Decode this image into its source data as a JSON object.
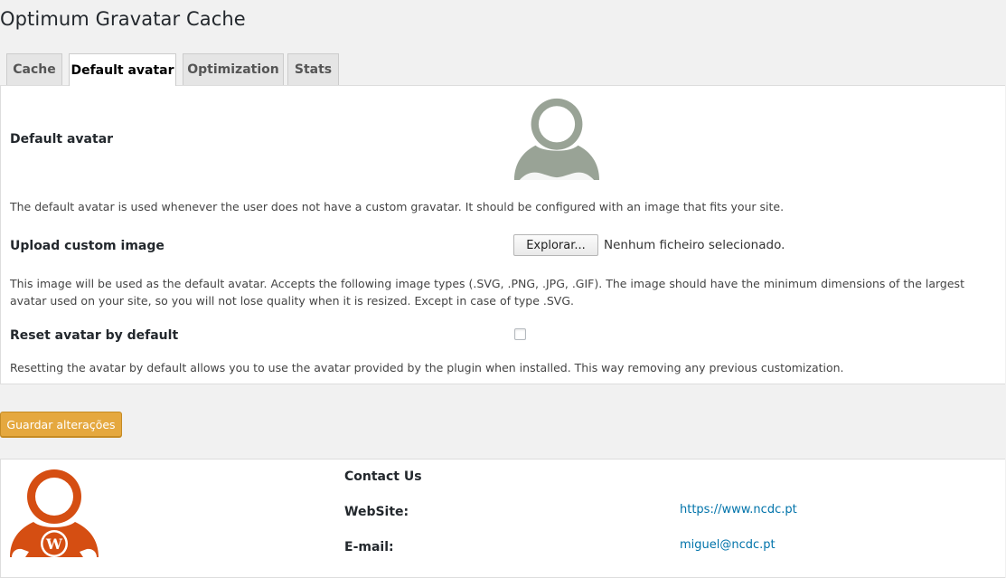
{
  "page_title": "Optimum Gravatar Cache",
  "tabs": [
    {
      "label": "Cache",
      "active": false
    },
    {
      "label": "Default avatar",
      "active": true
    },
    {
      "label": "Optimization",
      "active": false
    },
    {
      "label": "Stats",
      "active": false
    }
  ],
  "default_avatar": {
    "label": "Default avatar",
    "image_icon": "default-avatar-person-icon",
    "description": "The default avatar is used whenever the user does not have a custom gravatar. It should be configured with an image that fits your site."
  },
  "upload": {
    "label": "Upload custom image",
    "button_label": "Explorar...",
    "status": "Nenhum ficheiro selecionado.",
    "description": "This image will be used as the default avatar. Accepts the following image types (.SVG, .PNG, .JPG, .GIF). The image should have the minimum dimensions of the largest avatar used on your site, so you will not lose quality when it is resized. Except in case of type .SVG."
  },
  "reset": {
    "label": "Reset avatar by default",
    "checked": false,
    "description": "Resetting the avatar by default allows you to use the avatar provided by the plugin when installed. This way removing any previous customization."
  },
  "save_button": "Guardar alterações",
  "contact": {
    "title": "Contact Us",
    "website_label": "WebSite:",
    "website_value": "https://www.ncdc.pt",
    "email_label": "E-mail:",
    "email_value": "miguel@ncdc.pt",
    "logo_icon": "wordpress-avatar-icon"
  },
  "colors": {
    "avatar_grey": "#99a396",
    "brand_orange": "#d54e12",
    "save_button": "#e5a83f",
    "link": "#0073aa"
  }
}
